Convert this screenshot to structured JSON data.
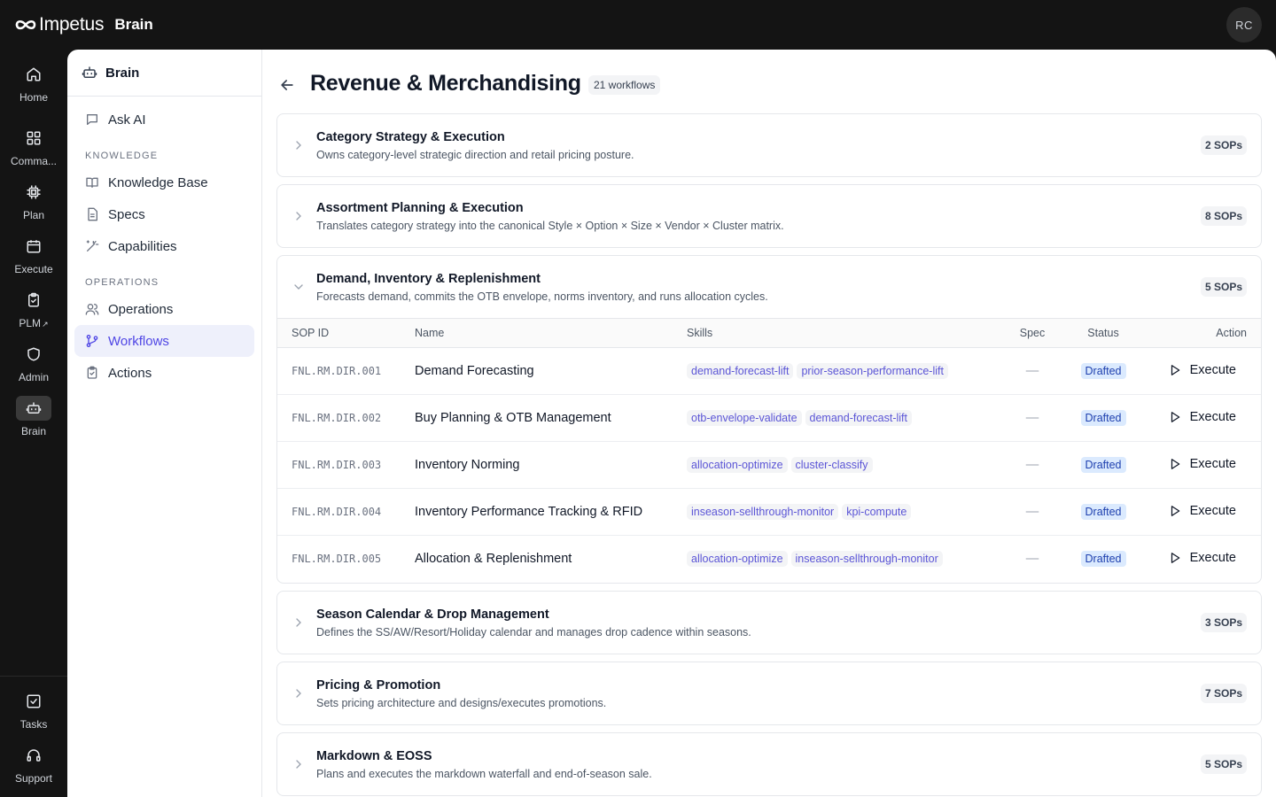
{
  "app": {
    "logo_text": "Impetus",
    "product": "Brain",
    "user_initials": "RC"
  },
  "rail": [
    {
      "label": "Home",
      "icon": "home-icon"
    },
    {
      "label": "Comma...",
      "icon": "grid-icon"
    },
    {
      "label": "Plan",
      "icon": "chip-icon"
    },
    {
      "label": "Execute",
      "icon": "calendar-icon"
    },
    {
      "label": "PLM",
      "icon": "clipboard-icon"
    },
    {
      "label": "Admin",
      "icon": "shield-icon"
    },
    {
      "label": "Brain",
      "icon": "robot-icon"
    },
    {
      "label": "Tasks",
      "icon": "checkbox-icon"
    },
    {
      "label": "Support",
      "icon": "headphones-icon"
    }
  ],
  "sidebar": {
    "title": "Brain",
    "ask_ai": "Ask AI",
    "knowledge_heading": "KNOWLEDGE",
    "knowledge_items": [
      "Knowledge Base",
      "Specs",
      "Capabilities"
    ],
    "operations_heading": "OPERATIONS",
    "operations_items": [
      "Operations",
      "Workflows",
      "Actions"
    ]
  },
  "page": {
    "title": "Revenue & Merchandising",
    "count": "21 workflows"
  },
  "table_headers": {
    "sop_id": "SOP ID",
    "name": "Name",
    "skills": "Skills",
    "spec": "Spec",
    "status": "Status",
    "action": "Action"
  },
  "groups": [
    {
      "title": "Category Strategy & Execution",
      "desc": "Owns category-level strategic direction and retail pricing posture.",
      "sops": "2 SOPs"
    },
    {
      "title": "Assortment Planning & Execution",
      "desc": "Translates category strategy into the canonical Style × Option × Size × Vendor × Cluster matrix.",
      "sops": "8 SOPs"
    },
    {
      "title": "Demand, Inventory & Replenishment",
      "desc": "Forecasts demand, commits the OTB envelope, norms inventory, and runs allocation cycles.",
      "sops": "5 SOPs",
      "rows": [
        {
          "id": "FNL.RM.DIR.001",
          "name": "Demand Forecasting",
          "skills": [
            "demand-forecast-lift",
            "prior-season-performance-lift"
          ],
          "spec": "—",
          "status": "Drafted",
          "action": "Execute"
        },
        {
          "id": "FNL.RM.DIR.002",
          "name": "Buy Planning & OTB Management",
          "skills": [
            "otb-envelope-validate",
            "demand-forecast-lift"
          ],
          "spec": "—",
          "status": "Drafted",
          "action": "Execute"
        },
        {
          "id": "FNL.RM.DIR.003",
          "name": "Inventory Norming",
          "skills": [
            "allocation-optimize",
            "cluster-classify"
          ],
          "spec": "—",
          "status": "Drafted",
          "action": "Execute"
        },
        {
          "id": "FNL.RM.DIR.004",
          "name": "Inventory Performance Tracking & RFID",
          "skills": [
            "inseason-sellthrough-monitor",
            "kpi-compute"
          ],
          "spec": "—",
          "status": "Drafted",
          "action": "Execute"
        },
        {
          "id": "FNL.RM.DIR.005",
          "name": "Allocation & Replenishment",
          "skills": [
            "allocation-optimize",
            "inseason-sellthrough-monitor"
          ],
          "spec": "—",
          "status": "Drafted",
          "action": "Execute"
        }
      ]
    },
    {
      "title": "Season Calendar & Drop Management",
      "desc": "Defines the SS/AW/Resort/Holiday calendar and manages drop cadence within seasons.",
      "sops": "3 SOPs"
    },
    {
      "title": "Pricing & Promotion",
      "desc": "Sets pricing architecture and designs/executes promotions.",
      "sops": "7 SOPs"
    },
    {
      "title": "Markdown & EOSS",
      "desc": "Plans and executes the markdown waterfall and end-of-season sale.",
      "sops": "5 SOPs"
    }
  ]
}
